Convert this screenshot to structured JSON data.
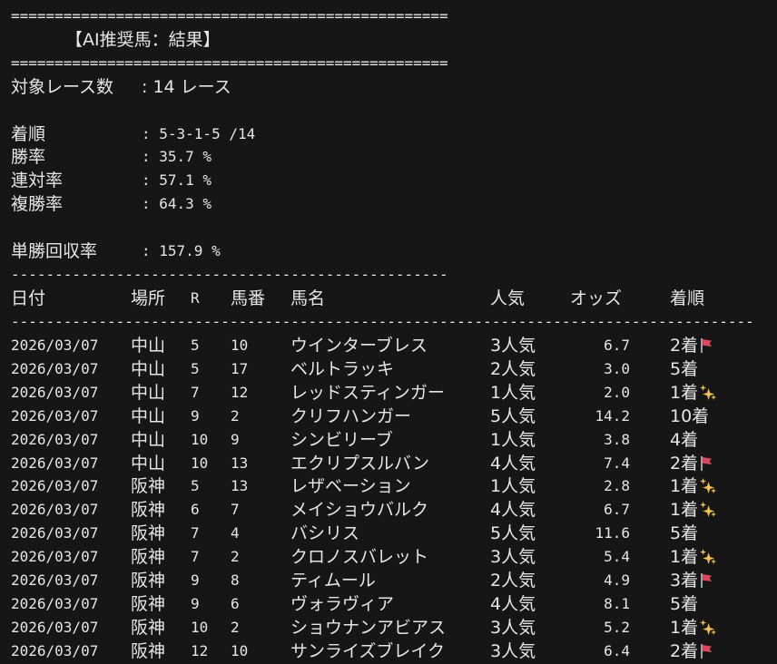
{
  "header": {
    "rule_top": "==================================================",
    "title": "【AI推奨馬：結果】",
    "rule_bottom": "=================================================="
  },
  "summary": {
    "race_count_label": "対象レース数",
    "race_count_value": ": 14 レース",
    "order_label": "着順",
    "order_value": ": 5-3-1-5 /14",
    "win_rate_label": "勝率",
    "win_rate_value": ": 35.7 %",
    "quinella_rate_label": "連対率",
    "quinella_rate_value": ": 57.1 %",
    "place_rate_label": "複勝率",
    "place_rate_value": ": 64.3 %",
    "roi_label": "単勝回収率",
    "roi_value": ": 157.9 %"
  },
  "table": {
    "rule_above_header": "--------------------------------------------------",
    "rule_below_header": "-------------------------------------------------------------------------------------",
    "columns": {
      "date": "日付",
      "venue": "場所",
      "race": "R",
      "horse_no": "馬番",
      "horse_name": "馬名",
      "popularity": "人気",
      "odds": "オッズ",
      "finish": "着順"
    },
    "rows": [
      {
        "date": "2026/03/07",
        "venue": "中山",
        "race": "5",
        "horse_no": "10",
        "horse_name": "ウインターブレス",
        "popularity": "3人気",
        "odds": "6.7",
        "finish": "2着",
        "icon": "flag"
      },
      {
        "date": "2026/03/07",
        "venue": "中山",
        "race": "5",
        "horse_no": "17",
        "horse_name": "ベルトラッキ",
        "popularity": "2人気",
        "odds": "3.0",
        "finish": "5着",
        "icon": ""
      },
      {
        "date": "2026/03/07",
        "venue": "中山",
        "race": "7",
        "horse_no": "12",
        "horse_name": "レッドスティンガー",
        "popularity": "1人気",
        "odds": "2.0",
        "finish": "1着",
        "icon": "sparkle"
      },
      {
        "date": "2026/03/07",
        "venue": "中山",
        "race": "9",
        "horse_no": "2",
        "horse_name": "クリフハンガー",
        "popularity": "5人気",
        "odds": "14.2",
        "finish": "10着",
        "icon": ""
      },
      {
        "date": "2026/03/07",
        "venue": "中山",
        "race": "10",
        "horse_no": "9",
        "horse_name": "シンビリーブ",
        "popularity": "1人気",
        "odds": "3.8",
        "finish": "4着",
        "icon": ""
      },
      {
        "date": "2026/03/07",
        "venue": "中山",
        "race": "10",
        "horse_no": "13",
        "horse_name": "エクリプスルバン",
        "popularity": "4人気",
        "odds": "7.4",
        "finish": "2着",
        "icon": "flag"
      },
      {
        "date": "2026/03/07",
        "venue": "阪神",
        "race": "5",
        "horse_no": "13",
        "horse_name": "レザベーション",
        "popularity": "1人気",
        "odds": "2.8",
        "finish": "1着",
        "icon": "sparkle"
      },
      {
        "date": "2026/03/07",
        "venue": "阪神",
        "race": "6",
        "horse_no": "7",
        "horse_name": "メイショウバルク",
        "popularity": "4人気",
        "odds": "6.7",
        "finish": "1着",
        "icon": "sparkle"
      },
      {
        "date": "2026/03/07",
        "venue": "阪神",
        "race": "7",
        "horse_no": "4",
        "horse_name": "バシリス",
        "popularity": "5人気",
        "odds": "11.6",
        "finish": "5着",
        "icon": ""
      },
      {
        "date": "2026/03/07",
        "venue": "阪神",
        "race": "7",
        "horse_no": "2",
        "horse_name": "クロノスバレット",
        "popularity": "3人気",
        "odds": "5.4",
        "finish": "1着",
        "icon": "sparkle"
      },
      {
        "date": "2026/03/07",
        "venue": "阪神",
        "race": "9",
        "horse_no": "8",
        "horse_name": "ティムール",
        "popularity": "2人気",
        "odds": "4.9",
        "finish": "3着",
        "icon": "flag"
      },
      {
        "date": "2026/03/07",
        "venue": "阪神",
        "race": "9",
        "horse_no": "6",
        "horse_name": "ヴォラヴィア",
        "popularity": "4人気",
        "odds": "8.1",
        "finish": "5着",
        "icon": ""
      },
      {
        "date": "2026/03/07",
        "venue": "阪神",
        "race": "10",
        "horse_no": "2",
        "horse_name": "ショウナンアビアス",
        "popularity": "3人気",
        "odds": "5.2",
        "finish": "1着",
        "icon": "sparkle"
      },
      {
        "date": "2026/03/07",
        "venue": "阪神",
        "race": "12",
        "horse_no": "10",
        "horse_name": "サンライズブレイク",
        "popularity": "3人気",
        "odds": "6.4",
        "finish": "2着",
        "icon": "flag"
      }
    ]
  }
}
